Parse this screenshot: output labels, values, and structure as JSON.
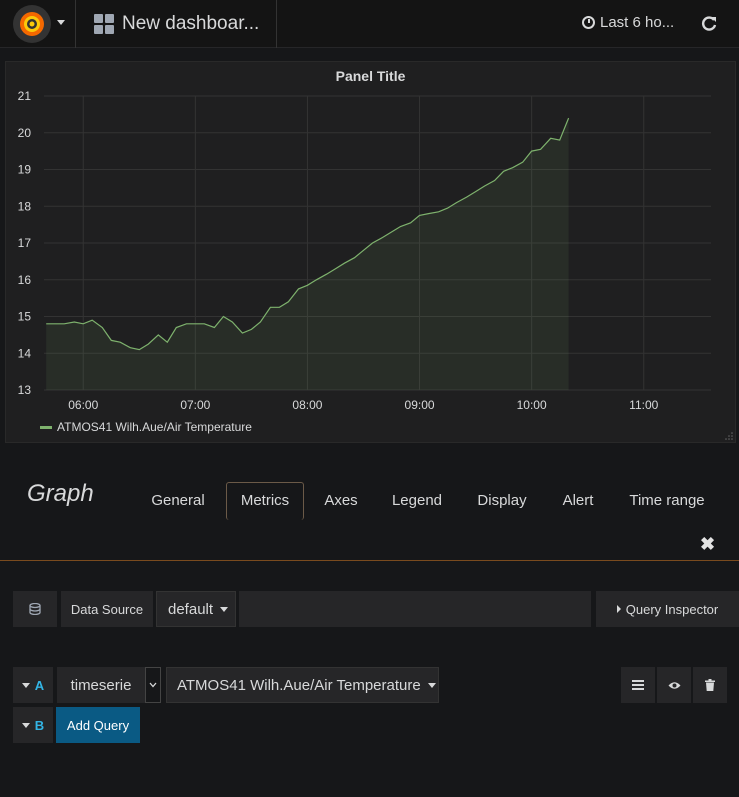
{
  "navbar": {
    "dashboard_title": "New dashboar...",
    "time_range": "Last 6 ho..."
  },
  "panel": {
    "title": "Panel Title",
    "legend_label": "ATMOS41 Wilh.Aue/Air Temperature"
  },
  "chart_data": {
    "type": "area",
    "title": "Panel Title",
    "xlabel": "",
    "ylabel": "",
    "ylim": [
      13,
      21
    ],
    "yticks": [
      "13",
      "14",
      "15",
      "16",
      "17",
      "18",
      "19",
      "20",
      "21"
    ],
    "xticks": [
      "06:00",
      "07:00",
      "08:00",
      "09:00",
      "10:00",
      "11:00"
    ],
    "xlim_hours": [
      5.65,
      11.6
    ],
    "grid": true,
    "legend": "bottom-left",
    "color": "#7eb26d",
    "series": [
      {
        "name": "ATMOS41 Wilh.Aue/Air Temperature",
        "x": [
          5.67,
          5.75,
          5.83,
          5.92,
          6.0,
          6.08,
          6.17,
          6.25,
          6.33,
          6.42,
          6.5,
          6.58,
          6.67,
          6.75,
          6.83,
          6.92,
          7.0,
          7.08,
          7.17,
          7.25,
          7.33,
          7.42,
          7.5,
          7.58,
          7.67,
          7.75,
          7.83,
          7.92,
          8.0,
          8.08,
          8.17,
          8.25,
          8.33,
          8.42,
          8.5,
          8.58,
          8.67,
          8.75,
          8.83,
          8.92,
          9.0,
          9.08,
          9.17,
          9.25,
          9.33,
          9.42,
          9.5,
          9.58,
          9.67,
          9.75,
          9.83,
          9.92,
          10.0,
          10.08,
          10.17,
          10.25,
          10.33
        ],
        "values": [
          14.8,
          14.8,
          14.8,
          14.85,
          14.8,
          14.9,
          14.7,
          14.35,
          14.3,
          14.15,
          14.1,
          14.25,
          14.5,
          14.3,
          14.7,
          14.8,
          14.8,
          14.8,
          14.7,
          15.0,
          14.85,
          14.55,
          14.65,
          14.85,
          15.25,
          15.25,
          15.4,
          15.75,
          15.85,
          16.0,
          16.15,
          16.3,
          16.45,
          16.6,
          16.8,
          17.0,
          17.15,
          17.3,
          17.45,
          17.55,
          17.75,
          17.8,
          17.85,
          17.95,
          18.1,
          18.25,
          18.4,
          18.55,
          18.7,
          18.95,
          19.05,
          19.2,
          19.5,
          19.55,
          19.85,
          19.8,
          20.4
        ]
      }
    ]
  },
  "editor": {
    "title": "Graph",
    "tabs": [
      "General",
      "Metrics",
      "Axes",
      "Legend",
      "Display",
      "Alert",
      "Time range"
    ],
    "active_tab": "Metrics",
    "close_symbol": "✖",
    "data_source_label": "Data Source",
    "data_source_value": "default",
    "query_inspector": "Query Inspector",
    "query_a_letter": "A",
    "query_a_measurement": "timeserie",
    "query_a_series": "ATMOS41 Wilh.Aue/Air Temperature",
    "query_b_letter": "B",
    "add_query": "Add Query"
  },
  "colors": {
    "accent": "#eb7b18",
    "series": "#7eb26d",
    "primary_button": "#0a5a84",
    "query_letter": "#33b5e5"
  }
}
